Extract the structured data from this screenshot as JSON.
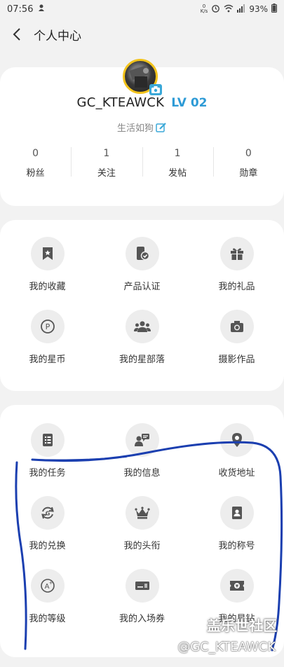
{
  "status_bar": {
    "time": "07:56",
    "speed_value": "0",
    "speed_unit": "K/s",
    "battery": "93%"
  },
  "header": {
    "title": "个人中心",
    "back_icon": "chevron-left-icon"
  },
  "profile": {
    "username": "GC_KTEAWCK",
    "level": "LV 02",
    "signature": "生活如狗",
    "stats": [
      {
        "value": "0",
        "label": "粉丝"
      },
      {
        "value": "1",
        "label": "关注"
      },
      {
        "value": "1",
        "label": "发帖"
      },
      {
        "value": "0",
        "label": "勋章"
      }
    ]
  },
  "menu_group_1": [
    {
      "label": "我的收藏",
      "icon": "bookmark-icon"
    },
    {
      "label": "产品认证",
      "icon": "device-verify-icon"
    },
    {
      "label": "我的礼品",
      "icon": "gift-icon"
    },
    {
      "label": "我的星币",
      "icon": "coin-icon"
    },
    {
      "label": "我的星部落",
      "icon": "group-icon"
    },
    {
      "label": "摄影作品",
      "icon": "camera-icon"
    }
  ],
  "menu_group_2": [
    {
      "label": "我的任务",
      "icon": "task-list-icon"
    },
    {
      "label": "我的信息",
      "icon": "message-icon"
    },
    {
      "label": "收货地址",
      "icon": "location-pin-icon"
    },
    {
      "label": "我的兑换",
      "icon": "exchange-icon"
    },
    {
      "label": "我的头衔",
      "icon": "crown-icon"
    },
    {
      "label": "我的称号",
      "icon": "title-card-icon"
    },
    {
      "label": "我的等级",
      "icon": "grade-icon"
    },
    {
      "label": "我的入场券",
      "icon": "ticket-icon"
    },
    {
      "label": "我的星钻",
      "icon": "star-diamond-icon"
    }
  ],
  "watermark": {
    "logo": "盖乐世社区",
    "handle": "@GC_KTEAWCK"
  },
  "colors": {
    "accent_level": "#2e9bd6",
    "annotation_stroke": "#1b3fb0",
    "icon_bg": "#ededed",
    "avatar_ring": "#f2c31b"
  }
}
